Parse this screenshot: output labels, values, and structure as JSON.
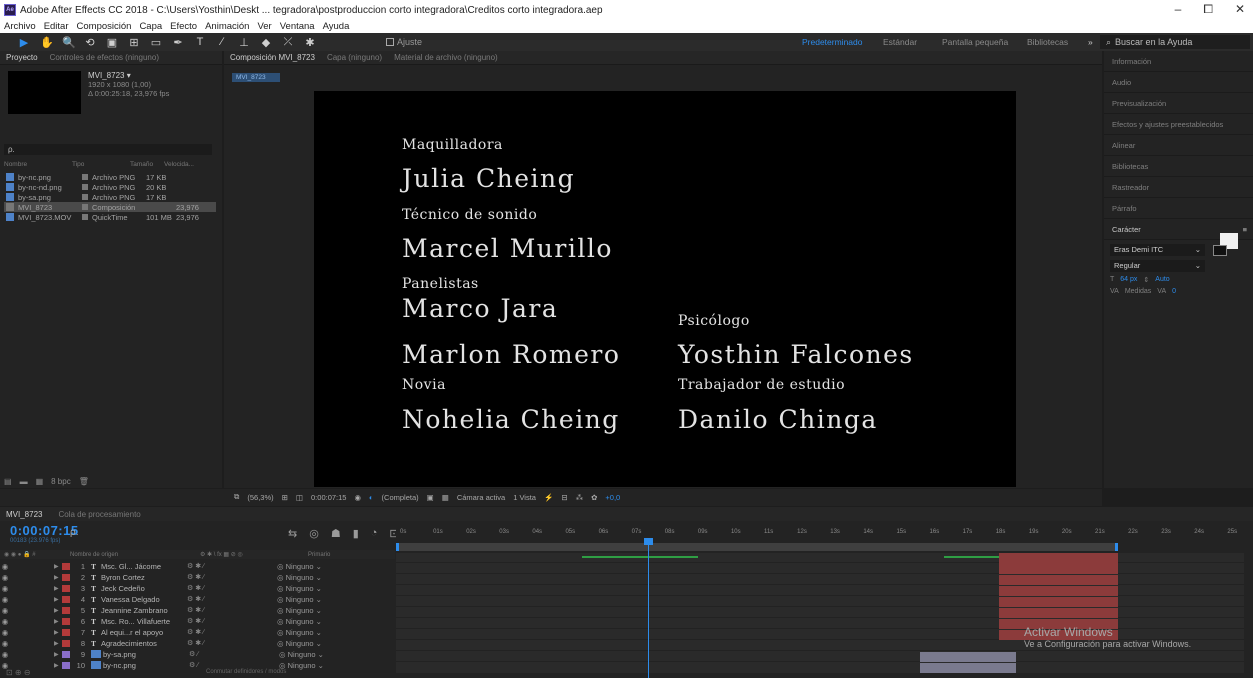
{
  "window": {
    "title": "Adobe After Effects CC 2018 - C:\\Users\\Yosthin\\Deskt ... tegradora\\postproduccion corto integradora\\Creditos corto integradora.aep",
    "minimize": "–",
    "maximize": "⧠",
    "close": "✕"
  },
  "menu": [
    "Archivo",
    "Editar",
    "Composición",
    "Capa",
    "Efecto",
    "Animación",
    "Ver",
    "Ventana",
    "Ayuda"
  ],
  "toolbar": {
    "ajuste_label": "Ajuste",
    "workspaces": [
      "Predeterminado",
      "Estándar",
      "Pantalla pequeña",
      "Bibliotecas"
    ],
    "active_workspace": "Predeterminado",
    "more": "»",
    "search_help_placeholder": "Buscar en la Ayuda"
  },
  "project_panel": {
    "tabs": [
      "Proyecto",
      "Controles de efectos (ninguno)"
    ],
    "comp_name": "MVI_8723 ▾",
    "comp_dims": "1920 x 1080 (1,00)",
    "comp_duration": "Δ 0:00:25:18, 23,976 fps",
    "search_placeholder": "ρ.",
    "columns": [
      "Nombre",
      "Tipo",
      "Tamaño",
      "Velocida..."
    ],
    "items": [
      {
        "name": "by-nc.png",
        "type": "Archivo PNG",
        "size": "17 KB",
        "rate": "",
        "kind": "png"
      },
      {
        "name": "by-nc-nd.png",
        "type": "Archivo PNG",
        "size": "20 KB",
        "rate": "",
        "kind": "png"
      },
      {
        "name": "by-sa.png",
        "type": "Archivo PNG",
        "size": "17 KB",
        "rate": "",
        "kind": "png"
      },
      {
        "name": "MVI_8723",
        "type": "Composición",
        "size": "",
        "rate": "23,976",
        "kind": "comp"
      },
      {
        "name": "MVI_8723.MOV",
        "type": "QuickTime",
        "size": "101 MB",
        "rate": "23,976",
        "kind": "mov"
      }
    ],
    "footer_bpc": "8 bpc"
  },
  "viewer": {
    "tabs": [
      "Composición MVI_8723",
      "Capa (ninguno)",
      "Material de archivo (ninguno)"
    ],
    "active_chip": "MVI_8723",
    "credits": [
      {
        "role": "Maquilladora",
        "name": "Julia Cheing"
      },
      {
        "role": "Técnico de sonido",
        "name": "Marcel Murillo"
      },
      {
        "role": "Panelistas",
        "name": "Marco Jara"
      },
      {
        "role": "",
        "name": "Marlon Romero"
      },
      {
        "role": "Novia",
        "name": "Nohelia Cheing"
      },
      {
        "role": "Psicólogo",
        "name": "Yosthin Falcones"
      },
      {
        "role": "Trabajador de estudio",
        "name": "Danilo Chinga"
      }
    ],
    "footer": {
      "zoom": "(56,3%)",
      "timecode": "0:00:07:15",
      "resolution": "(Completa)",
      "camera": "Cámara activa",
      "views": "1 Vista",
      "exposure": "+0,0"
    }
  },
  "right_panels": {
    "items": [
      "Información",
      "Audio",
      "Previsualización",
      "Efectos y ajustes preestablecidos",
      "Alinear",
      "Bibliotecas",
      "Rastreador",
      "Párrafo"
    ],
    "character": {
      "title": "Carácter",
      "font": "Eras Demi ITC",
      "style": "Regular",
      "size": "64 px",
      "leading": "Auto",
      "kerning": "Medidas",
      "tracking": "0"
    }
  },
  "timeline": {
    "tabs": [
      "MVI_8723",
      "Cola de procesamiento"
    ],
    "timecode": "0:00:07:15",
    "fps_label": "00183 (23.976 fps)",
    "header_source": "Nombre de origen",
    "header_parent": "Primario",
    "layers": [
      {
        "num": "1",
        "type": "T",
        "name": "Msc. Gl... Jácome",
        "parent": "Ninguno",
        "color": "#b33a3a"
      },
      {
        "num": "2",
        "type": "T",
        "name": "Byron Cortez",
        "parent": "Ninguno",
        "color": "#b33a3a"
      },
      {
        "num": "3",
        "type": "T",
        "name": "Jeck Cedeño",
        "parent": "Ninguno",
        "color": "#b33a3a"
      },
      {
        "num": "4",
        "type": "T",
        "name": "Vanessa Delgado",
        "parent": "Ninguno",
        "color": "#b33a3a"
      },
      {
        "num": "5",
        "type": "T",
        "name": "Jeannine Zambrano",
        "parent": "Ninguno",
        "color": "#b33a3a"
      },
      {
        "num": "6",
        "type": "T",
        "name": "Msc. Ro... Villafuerte",
        "parent": "Ninguno",
        "color": "#b33a3a"
      },
      {
        "num": "7",
        "type": "T",
        "name": "Al equi...r el apoyo",
        "parent": "Ninguno",
        "color": "#b33a3a"
      },
      {
        "num": "8",
        "type": "T",
        "name": "Agradecimientos",
        "parent": "Ninguno",
        "color": "#b33a3a"
      },
      {
        "num": "9",
        "type": "F",
        "name": "by-sa.png",
        "parent": "Ninguno",
        "color": "#8a6ec9"
      },
      {
        "num": "10",
        "type": "F",
        "name": "by-nc.png",
        "parent": "Ninguno",
        "color": "#8a6ec9"
      }
    ],
    "ruler": [
      "0s",
      "01s",
      "02s",
      "03s",
      "04s",
      "05s",
      "06s",
      "07s",
      "08s",
      "09s",
      "10s",
      "11s",
      "12s",
      "13s",
      "14s",
      "15s",
      "16s",
      "17s",
      "18s",
      "19s",
      "20s",
      "21s",
      "22s",
      "23s",
      "24s",
      "25s"
    ],
    "footer": "Conmutar definidores / modos"
  },
  "activation": {
    "title": "Activar Windows",
    "subtitle": "Ve a Configuración para activar Windows."
  }
}
